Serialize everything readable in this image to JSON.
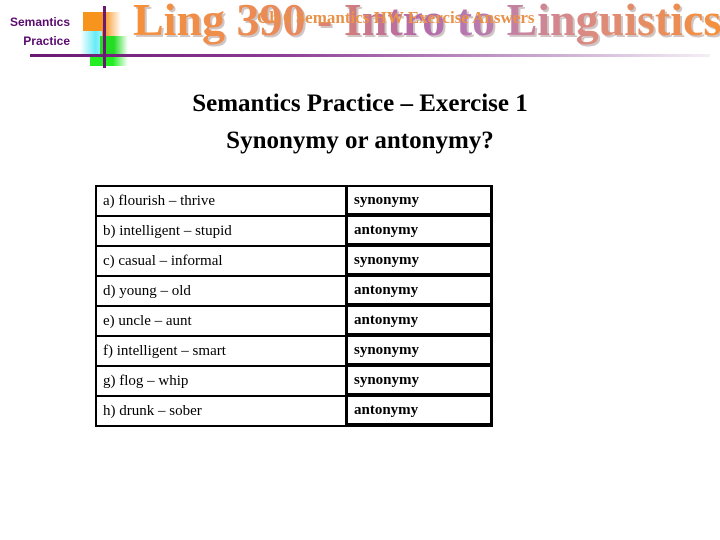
{
  "header": {
    "side_label_line1": "Semantics",
    "side_label_line2": "Practice",
    "course_title": "Ling 390 - Intro to Linguistics",
    "subtitle": "Ch 6 Semantics HW Exercise Answers",
    "colors": {
      "side_label": "#5a0a6e",
      "title_orange": "#f5903a",
      "title_purple": "#b46aa8",
      "rule_purple": "#6a1a72"
    }
  },
  "main": {
    "heading_line1": "Semantics Practice – Exercise 1",
    "heading_line2": "Synonymy or antonymy?",
    "rows": [
      {
        "pair": "a) flourish – thrive",
        "answer": "synonymy"
      },
      {
        "pair": "b) intelligent – stupid",
        "answer": "antonymy"
      },
      {
        "pair": "c) casual – informal",
        "answer": "synonymy"
      },
      {
        "pair": "d) young – old",
        "answer": "antonymy"
      },
      {
        "pair": "e) uncle – aunt",
        "answer": "antonymy"
      },
      {
        "pair": "f) intelligent – smart",
        "answer": "synonymy"
      },
      {
        "pair": "g) flog – whip",
        "answer": "synonymy"
      },
      {
        "pair": "h) drunk – sober",
        "answer": "antonymy"
      }
    ]
  }
}
